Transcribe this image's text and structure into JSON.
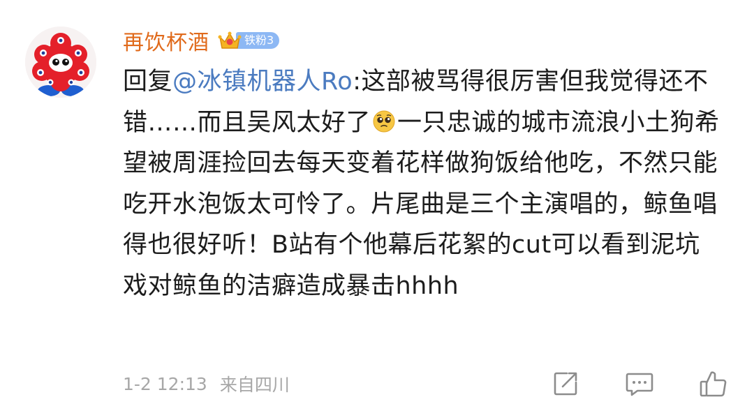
{
  "comment": {
    "username": "再饮杯酒",
    "fan_badge": "铁粉3",
    "reply_prefix": "回复",
    "mention": "@冰镇机器人Ro",
    "text_part1": ":这部被骂得很厉害但我觉得还不错……而且吴风太好了",
    "emoji": "pleading-face-emoji",
    "text_part2": "一只忠诚的城市流浪小土狗希望被周涯捡回去每天变着花样做狗饭给他吃，不然只能吃开水泡饭太可怜了。片尾曲是三个主演唱的，鲸鱼唱得也很好听！B站有个他幕后花絮的cut可以看到泥坑戏对鲸鱼的洁癖造成暴击hhhh",
    "time": "1-2 12:13",
    "location": "来自四川"
  },
  "icons": {
    "avatar": "red-monster-avatar",
    "badge": "crown-icon",
    "repost": "repost-icon",
    "comment": "comment-icon",
    "like": "like-icon"
  },
  "colors": {
    "username": "#e06a1b",
    "mention": "#4b7bc0",
    "badge": "#8db8f4",
    "meta": "#a7a7a7"
  }
}
